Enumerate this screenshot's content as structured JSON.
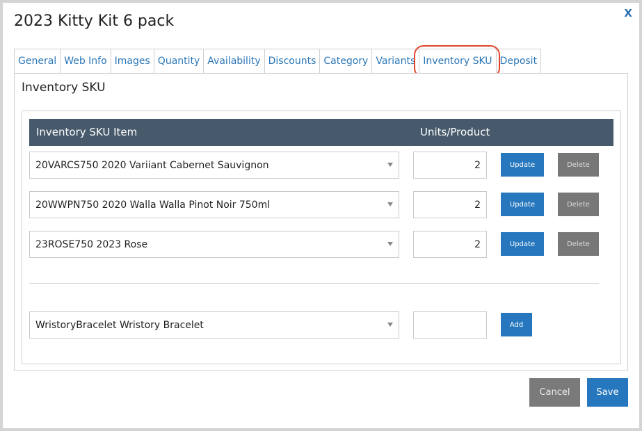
{
  "dialog": {
    "title": "2023 Kitty Kit 6 pack",
    "close_label": "X"
  },
  "tabs": [
    {
      "label": "General"
    },
    {
      "label": "Web Info"
    },
    {
      "label": "Images"
    },
    {
      "label": "Quantity"
    },
    {
      "label": "Availability"
    },
    {
      "label": "Discounts"
    },
    {
      "label": "Category"
    },
    {
      "label": "Variants"
    },
    {
      "label": "Inventory SKU",
      "active": true
    },
    {
      "label": "Deposit"
    }
  ],
  "panel": {
    "title": "Inventory SKU",
    "table_headers": {
      "item": "Inventory SKU Item",
      "units": "Units/Product"
    },
    "rows": [
      {
        "item": "20VARCS750 2020 Variiant Cabernet Sauvignon",
        "units": "2",
        "update_label": "Update",
        "delete_label": "Delete"
      },
      {
        "item": "20WWPN750 2020 Walla Walla Pinot Noir 750ml",
        "units": "2",
        "update_label": "Update",
        "delete_label": "Delete"
      },
      {
        "item": "23ROSE750 2023 Rose",
        "units": "2",
        "update_label": "Update",
        "delete_label": "Delete"
      }
    ],
    "new_row": {
      "item": "WristoryBracelet Wristory Bracelet",
      "units": "",
      "add_label": "Add"
    }
  },
  "footer": {
    "cancel_label": "Cancel",
    "save_label": "Save"
  },
  "colors": {
    "accent": "#2677bd",
    "header_bg": "#475a6c",
    "delete_bg": "#777777",
    "highlight": "#e0452b"
  }
}
